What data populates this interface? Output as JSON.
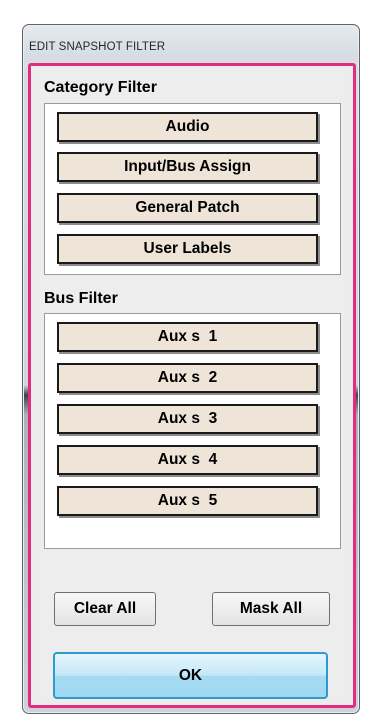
{
  "window": {
    "title": "EDIT SNAPSHOT FILTER"
  },
  "category_filter": {
    "label": "Category Filter",
    "buttons": [
      "Audio",
      "Input/Bus Assign",
      "General Patch",
      "User Labels"
    ]
  },
  "bus_filter": {
    "label": "Bus Filter",
    "buttons": [
      "Aux s  1",
      "Aux s  2",
      "Aux s  3",
      "Aux s  4",
      "Aux s  5"
    ]
  },
  "actions": {
    "clear_all": "Clear All",
    "mask_all": "Mask All",
    "ok": "OK"
  },
  "colors": {
    "accent_frame": "#e02d7d",
    "filter_button": "#eee5d8",
    "ok_border": "#2c9bd0"
  }
}
